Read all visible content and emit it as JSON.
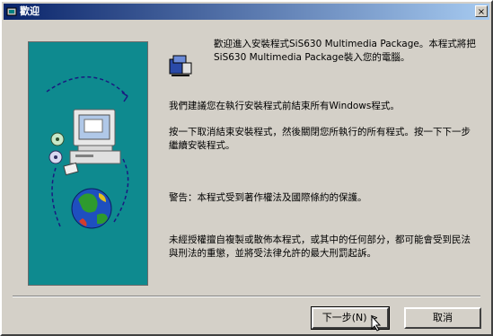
{
  "window": {
    "title": "歡迎",
    "close_glyph": "×"
  },
  "content": {
    "welcome_line": "歡迎進入安裝程式SiS630 Multimedia Package。本程式將把SiS630 Multimedia Package裝入您的電腦。",
    "recommend_line": "我們建議您在執行安裝程式前結束所有Windows程式。",
    "instruction_line": "按一下取消結束安裝程式，然後關閉您所執行的所有程式。按一下下一步繼續安裝程式。",
    "warning_line": "警告：本程式受到著作權法及國際條約的保護。",
    "legal_line": "未經授權擅自複製或散佈本程式，或其中的任何部分，都可能會受到民法與刑法的重懲，並將受法律允許的最大刑罰起訴。"
  },
  "buttons": {
    "next_label": "下一步(N) >",
    "cancel_label": "取消"
  },
  "colors": {
    "panel_bg": "#0e8a8f",
    "dialog_bg": "#d4d0c8",
    "titlebar_start": "#0a246a",
    "titlebar_end": "#a6caf0"
  },
  "icons": {
    "title_icon": "setup-icon",
    "wizard_art": "computer-globe-icon",
    "message_icon": "setup-box-icon"
  }
}
